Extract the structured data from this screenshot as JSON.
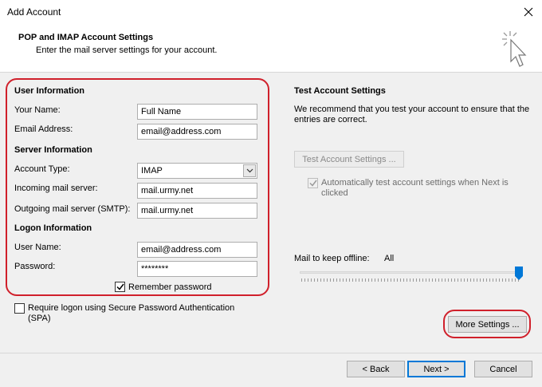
{
  "window": {
    "title": "Add Account"
  },
  "header": {
    "title": "POP and IMAP Account Settings",
    "subtitle": "Enter the mail server settings for your account."
  },
  "user_info": {
    "heading": "User Information",
    "your_name_label": "Your Name:",
    "your_name_value": "Full Name",
    "email_label": "Email Address:",
    "email_value": "email@address.com"
  },
  "server_info": {
    "heading": "Server Information",
    "account_type_label": "Account Type:",
    "account_type_value": "IMAP",
    "incoming_label": "Incoming mail server:",
    "incoming_value": "mail.urmy.net",
    "outgoing_label": "Outgoing mail server (SMTP):",
    "outgoing_value": "mail.urmy.net"
  },
  "logon_info": {
    "heading": "Logon Information",
    "username_label": "User Name:",
    "username_value": "email@address.com",
    "password_label": "Password:",
    "password_value": "********",
    "remember_label": "Remember password",
    "remember_checked": true
  },
  "spa": {
    "label": "Require logon using Secure Password Authentication (SPA)",
    "checked": false
  },
  "test_settings": {
    "heading": "Test Account Settings",
    "description": "We recommend that you test your account to ensure that the entries are correct.",
    "test_button": "Test Account Settings ...",
    "auto_test_label": "Automatically test account settings when Next is clicked",
    "auto_test_checked": true
  },
  "offline": {
    "label": "Mail to keep offline:",
    "value": "All",
    "slider_fraction": 1.0
  },
  "buttons": {
    "more_settings": "More Settings ...",
    "back": "< Back",
    "next": "Next >",
    "cancel": "Cancel"
  },
  "colors": {
    "highlight_ring": "#d0202b",
    "default_button_border": "#0078d7"
  }
}
